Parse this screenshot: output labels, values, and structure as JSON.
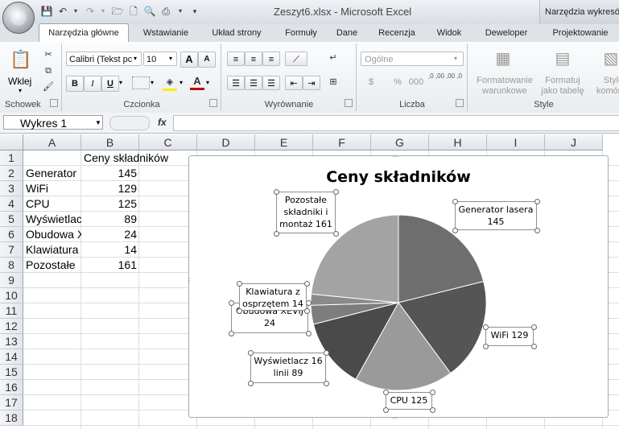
{
  "window": {
    "doc_title": "Zeszyt6.xlsx - Microsoft Excel",
    "contextual_title": "Narzędzia wykresów"
  },
  "quick_access": {
    "save_icon": "save-icon",
    "undo_icon": "undo-icon",
    "redo_icon": "redo-icon"
  },
  "tabs": [
    "Narzędzia główne",
    "Wstawianie",
    "Układ strony",
    "Formuły",
    "Dane",
    "Recenzja",
    "Widok",
    "Deweloper",
    "Projektowanie"
  ],
  "ribbon": {
    "clipboard": {
      "label": "Schowek",
      "paste": "Wklej"
    },
    "font": {
      "label": "Czcionka",
      "font_name": "Calibri (Tekst pc",
      "font_size": "10",
      "bold": "B",
      "italic": "I",
      "underline": "U",
      "grow": "A",
      "shrink": "A",
      "color": "A"
    },
    "alignment": {
      "label": "Wyrównanie"
    },
    "number": {
      "label": "Liczba",
      "format": "Ogólne",
      "percent": "%",
      "thousands": "000",
      "inc_dec": ",0 ,00",
      "dec_dec": ",00 ,0"
    },
    "style": {
      "label": "Style",
      "conditional": "Formatowanie warunkowe",
      "as_table": "Formatuj jako tabelę",
      "cell_styles": "Style komórek"
    }
  },
  "formula_bar": {
    "name_box": "Wykres 1",
    "fx": "fx",
    "value": ""
  },
  "columns": [
    "A",
    "B",
    "C",
    "D",
    "E",
    "F",
    "G",
    "H",
    "I",
    "J"
  ],
  "rows": [
    "1",
    "2",
    "3",
    "4",
    "5",
    "6",
    "7",
    "8",
    "9",
    "10",
    "11",
    "12",
    "13",
    "14",
    "15",
    "16",
    "17",
    "18"
  ],
  "sheet": {
    "header": "Ceny składników",
    "items": [
      {
        "name": "Generator",
        "value": "145"
      },
      {
        "name": "WiFi",
        "value": "129"
      },
      {
        "name": "CPU",
        "value": "125"
      },
      {
        "name": "Wyświetlac",
        "value": "89"
      },
      {
        "name": "Obudowa X",
        "value": "24"
      },
      {
        "name": "Klawiatura",
        "value": "14"
      },
      {
        "name": "Pozostałe",
        "value": "161"
      }
    ]
  },
  "chart_data": {
    "type": "pie",
    "title": "Ceny składników",
    "categories": [
      "Generator lasera",
      "WiFi",
      "CPU",
      "Wyświetlacz 16 linii",
      "Obudowa XEVIJ",
      "Klawiatura z osprzętem",
      "Pozostałe składniki i montaż"
    ],
    "values": [
      145,
      129,
      125,
      89,
      24,
      14,
      161
    ],
    "colors": [
      "#6e6e6e",
      "#555555",
      "#9a9a9a",
      "#4a4a4a",
      "#7d7d7d",
      "#8a8a8a",
      "#a3a3a3"
    ],
    "labels": [
      "Generator lasera 145",
      "WiFi 129",
      "CPU 125",
      "Wyświetlacz 16 linii 89",
      "Obudowa XEVIJ 24",
      "Klawiatura z osprzętem 14",
      "Pozostałe składniki i montaż 161"
    ]
  }
}
